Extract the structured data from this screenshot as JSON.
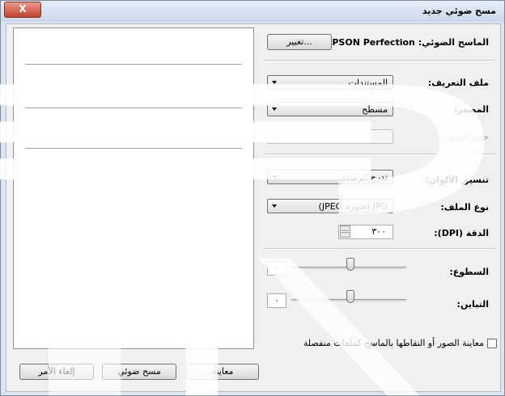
{
  "window": {
    "title": "مسح ضوئي جديد",
    "close_label": "X"
  },
  "scanner": {
    "label": "الماسح الضوئي:",
    "name": "EPSON Perfection",
    "change_button": "تغيير..."
  },
  "settings": {
    "profile_label": "ملف التعريف:",
    "profile_value": "المستندات",
    "source_label": "المصدر:",
    "source_value": "مسطح",
    "paper_size_label": "حجم الورق:",
    "paper_size_value": "",
    "color_format_label": "تنسيق الألوان:",
    "color_format_value": "تدرج الرمادي",
    "file_type_label": "نوع الملف:",
    "file_type_value": "JPG (صورة JPEG)",
    "resolution_label": "الدقة (DPI):",
    "resolution_value": "٣٠٠",
    "brightness_label": "السطوع:",
    "brightness_value": "٠",
    "contrast_label": "التباين:",
    "contrast_value": "٠"
  },
  "checkbox": {
    "label": "معاينة الصور أو التقاطها بالماسح كملفات منفصلة",
    "checked": false
  },
  "buttons": {
    "preview": "معاينة",
    "scan": "مسح ضوئي",
    "cancel": "إلغاء الأمر"
  }
}
